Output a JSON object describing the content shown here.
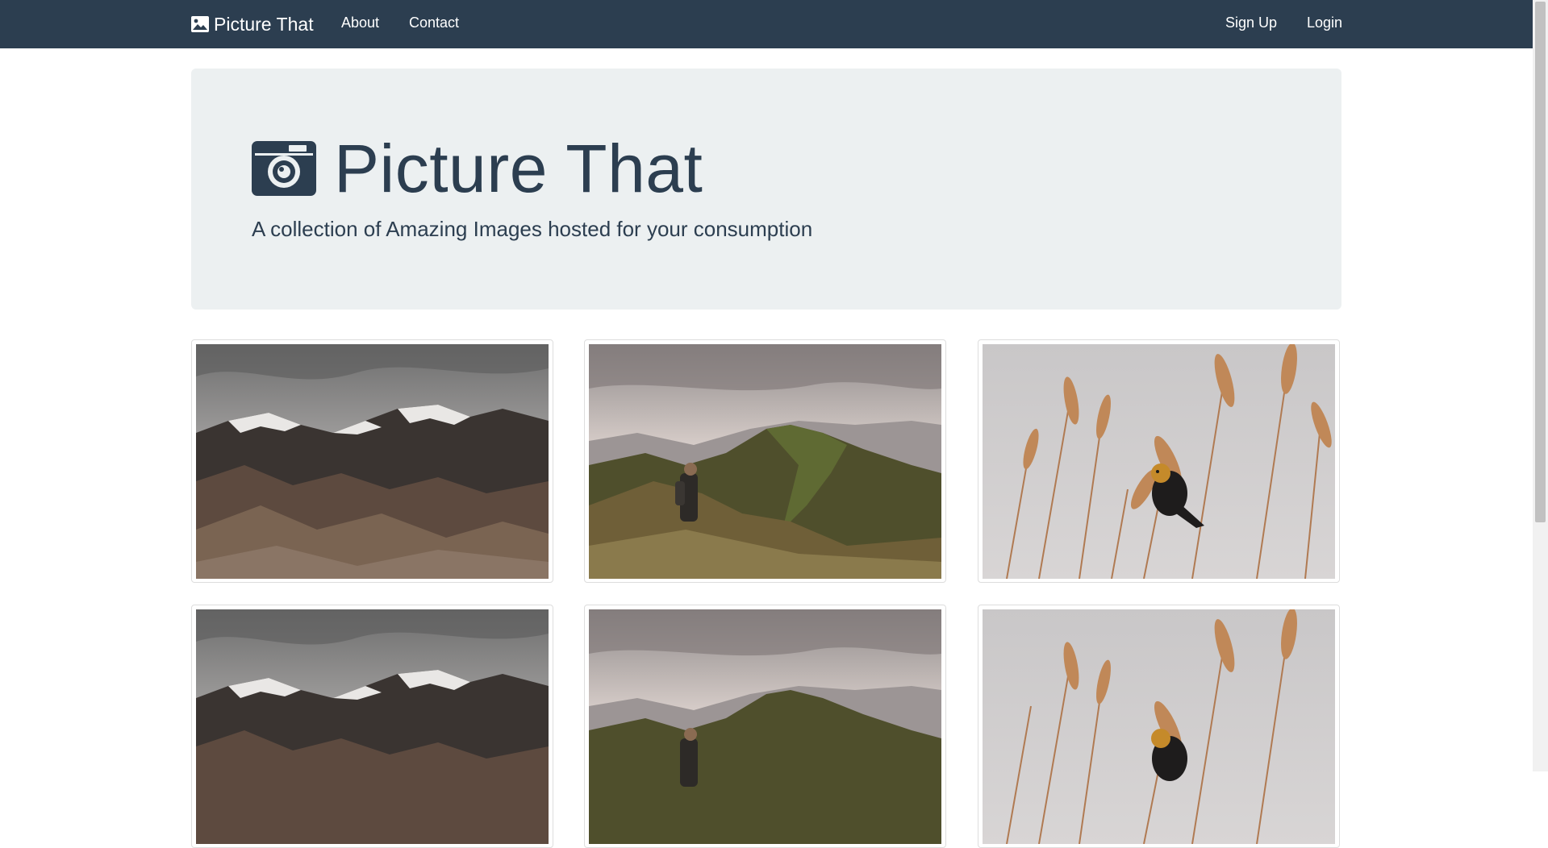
{
  "navbar": {
    "brand": "Picture That",
    "links": [
      "About",
      "Contact"
    ],
    "right_links": [
      "Sign Up",
      "Login"
    ],
    "background": "#2c3e50"
  },
  "jumbotron": {
    "title": "Picture That",
    "lead": "A collection of Amazing Images hosted for your consumption",
    "icon": "camera-icon",
    "background": "#ecf0f1"
  },
  "gallery": {
    "images": [
      {
        "subject": "mountains"
      },
      {
        "subject": "hiker"
      },
      {
        "subject": "bird"
      },
      {
        "subject": "mountains"
      },
      {
        "subject": "hiker"
      },
      {
        "subject": "bird"
      }
    ]
  }
}
